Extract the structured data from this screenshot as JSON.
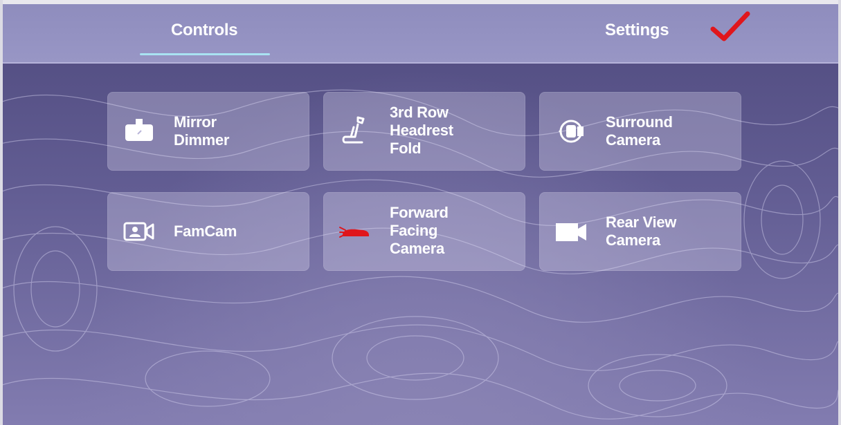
{
  "header": {
    "tabs": [
      {
        "label": "Controls",
        "active": true
      },
      {
        "label": "Settings",
        "active": false
      }
    ],
    "annotation_color": "#e0161c"
  },
  "tiles": [
    {
      "label_lines": [
        "Mirror",
        "Dimmer"
      ],
      "icon": "rearview-mirror-icon"
    },
    {
      "label_lines": [
        "3rd Row",
        "Headrest",
        "Fold"
      ],
      "icon": "seat-icon"
    },
    {
      "label_lines": [
        "Surround",
        "Camera"
      ],
      "icon": "surround-camera-icon"
    },
    {
      "label_lines": [
        "FamCam"
      ],
      "icon": "famcam-icon"
    },
    {
      "label_lines": [
        "Forward",
        "Facing",
        "Camera"
      ],
      "icon": "forward-camera-icon"
    },
    {
      "label_lines": [
        "Rear View",
        "Camera"
      ],
      "icon": "video-camera-icon"
    }
  ],
  "colors": {
    "accent_underline": "#a9e2f2",
    "header_bg": "#9391c2",
    "background": "#625d93",
    "forward_camera_icon": "#e0161c"
  }
}
